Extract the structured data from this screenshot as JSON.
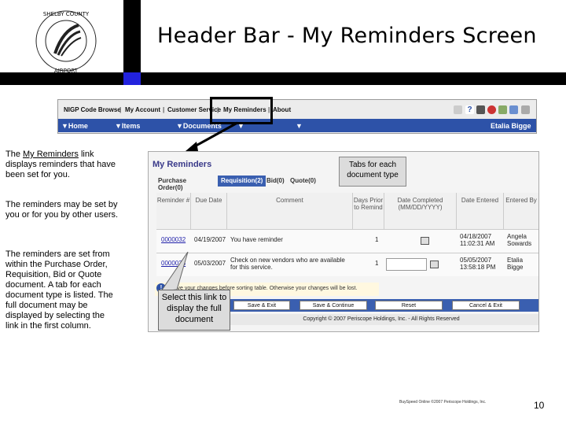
{
  "slide": {
    "title": "Header Bar - My Reminders Screen",
    "page_number": "10",
    "footer": "BuySpeed Online ©2007 Periscope Holdings, Inc."
  },
  "notes": {
    "note1_prefix": "The ",
    "note1_link": "My Reminders",
    "note1_suffix": " link displays reminders that have been set for you.",
    "note2": "The reminders may be set by you or for you by other users.",
    "note3": "The reminders are set from within the Purchase Order, Requisition, Bid or Quote document.  A tab for each document type is listed.  The full document may be displayed by selecting the link in the first column."
  },
  "topnav": {
    "items": [
      "NIGP Code Browse",
      "My Account",
      "Customer Service",
      "My Reminders",
      "About"
    ]
  },
  "mainnav": {
    "items": [
      "Home",
      "Items",
      "Documents"
    ],
    "user": "Etalia Bigge"
  },
  "reminders": {
    "title": "My Reminders",
    "tabs": [
      "Purchase Order(0)",
      "Requisition(2)",
      "Bid(0)",
      "Quote(0)"
    ],
    "columns": [
      "Reminder #",
      "Due Date",
      "Comment",
      "Days Prior to Remind",
      "Date Completed (MM/DD/YYYY)",
      "Date Entered",
      "Entered By"
    ],
    "rows": [
      {
        "id": "0000032",
        "due": "04/19/2007",
        "comment": "You have reminder",
        "days": "1",
        "entered": "04/18/2007 11:02:31 AM",
        "by": "Angela Sowards"
      },
      {
        "id": "0000038",
        "due": "05/03/2007",
        "comment": "Check on new vendors who are available for this service.",
        "days": "1",
        "entered": "05/05/2007 13:58:18 PM",
        "by": "Etalia Bigge"
      }
    ],
    "warning": "Save your changes before sorting table. Otherwise your changes will be lost.",
    "buttons": [
      "Save & Exit",
      "Save & Continue",
      "Reset",
      "Cancel & Exit"
    ],
    "copyright": "Copyright © 2007 Periscope Holdings, Inc. - All Rights Reserved"
  },
  "callouts": {
    "tabs": "Tabs for each document type",
    "link": "Select this link to display the full document"
  }
}
